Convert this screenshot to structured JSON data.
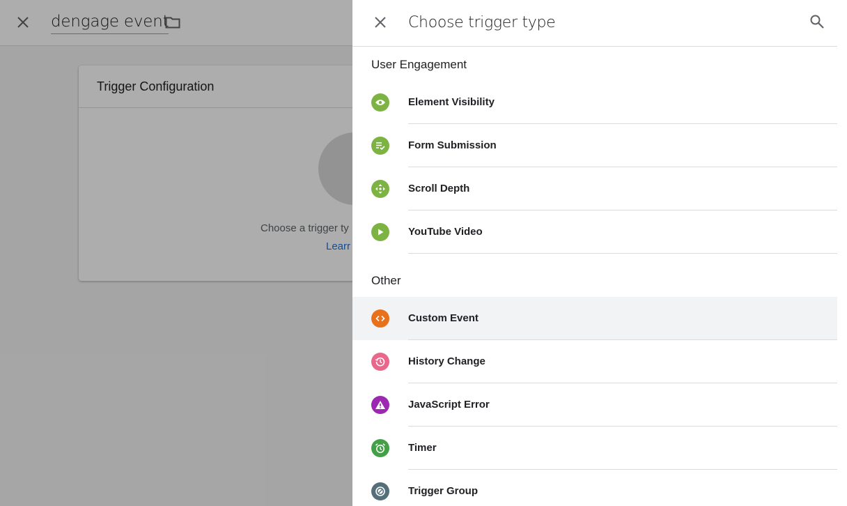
{
  "background": {
    "title": "dengage event",
    "card": {
      "header": "Trigger Configuration",
      "prompt_text": "Choose a trigger ty",
      "link_text": "Learr"
    }
  },
  "drawer": {
    "title": "Choose trigger type",
    "sections": [
      {
        "title": "User Engagement",
        "items": [
          {
            "label": "Element Visibility",
            "icon": "eye-icon",
            "color": "#7cb342"
          },
          {
            "label": "Form Submission",
            "icon": "form-check-icon",
            "color": "#7cb342"
          },
          {
            "label": "Scroll Depth",
            "icon": "scroll-arrows-icon",
            "color": "#7cb342"
          },
          {
            "label": "YouTube Video",
            "icon": "play-icon",
            "color": "#7cb342"
          }
        ]
      },
      {
        "title": "Other",
        "items": [
          {
            "label": "Custom Event",
            "icon": "code-icon",
            "color": "#e8711c",
            "highlighted": true
          },
          {
            "label": "History Change",
            "icon": "history-icon",
            "color": "#e8678a"
          },
          {
            "label": "JavaScript Error",
            "icon": "warning-icon",
            "color": "#9c27b0"
          },
          {
            "label": "Timer",
            "icon": "alarm-icon",
            "color": "#43a047"
          },
          {
            "label": "Trigger Group",
            "icon": "trigger-group-icon",
            "color": "#546e7a"
          }
        ]
      }
    ]
  }
}
